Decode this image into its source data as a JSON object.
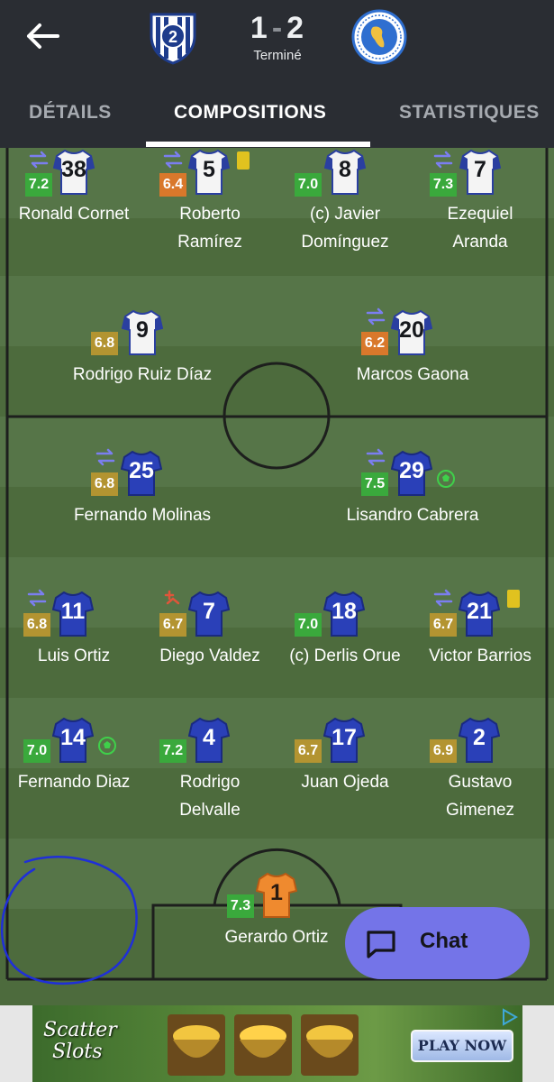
{
  "header": {
    "score_home": "1",
    "score_sep": "-",
    "score_away": "2",
    "status": "Terminé"
  },
  "tabs": [
    {
      "label": "DÉTAILS"
    },
    {
      "label": "COMPOSITIONS"
    },
    {
      "label": "STATISTIQUES"
    }
  ],
  "colors": {
    "rating_green": "#3aa93c",
    "rating_olive": "#b39431",
    "rating_orange": "#d9782b",
    "accent_chat": "#7474e8",
    "yellow_card": "#e0c21f"
  },
  "lineup": {
    "away_mid": [
      {
        "number": "38",
        "rating": "7.2",
        "name_line1": "Ronald Cornet",
        "name_line2": ""
      },
      {
        "number": "5",
        "rating": "6.4",
        "name_line1": "Roberto",
        "name_line2": "Ramírez"
      },
      {
        "number": "8",
        "rating": "7.0",
        "name_line1": "(c) Javier",
        "name_line2": "Domínguez"
      },
      {
        "number": "7",
        "rating": "7.3",
        "name_line1": "Ezequiel",
        "name_line2": "Aranda"
      }
    ],
    "away_fwd": [
      {
        "number": "9",
        "rating": "6.8",
        "name": "Rodrigo Ruiz Díaz"
      },
      {
        "number": "20",
        "rating": "6.2",
        "name": "Marcos Gaona"
      }
    ],
    "home_fwd": [
      {
        "number": "25",
        "rating": "6.8",
        "name": "Fernando Molinas"
      },
      {
        "number": "29",
        "rating": "7.5",
        "name": "Lisandro Cabrera"
      }
    ],
    "home_mid": [
      {
        "number": "11",
        "rating": "6.8",
        "name": "Luis Ortiz"
      },
      {
        "number": "7",
        "rating": "6.7",
        "name": "Diego Valdez"
      },
      {
        "number": "18",
        "rating": "7.0",
        "name": "(c) Derlis Orue"
      },
      {
        "number": "21",
        "rating": "6.7",
        "name": "Victor Barrios"
      }
    ],
    "home_def": [
      {
        "number": "14",
        "rating": "7.0",
        "name_line1": "Fernando Diaz",
        "name_line2": ""
      },
      {
        "number": "4",
        "rating": "7.2",
        "name_line1": "Rodrigo",
        "name_line2": "Delvalle"
      },
      {
        "number": "17",
        "rating": "6.7",
        "name_line1": "Juan Ojeda",
        "name_line2": ""
      },
      {
        "number": "2",
        "rating": "6.9",
        "name_line1": "Gustavo",
        "name_line2": "Gimenez"
      }
    ],
    "home_gk": {
      "number": "1",
      "rating": "7.3",
      "name": "Gerardo Ortiz"
    }
  },
  "chat": {
    "label": "Chat"
  },
  "ad": {
    "logo_line1": "Scatter",
    "logo_line2": "Slots",
    "cta": "PLAY NOW"
  }
}
